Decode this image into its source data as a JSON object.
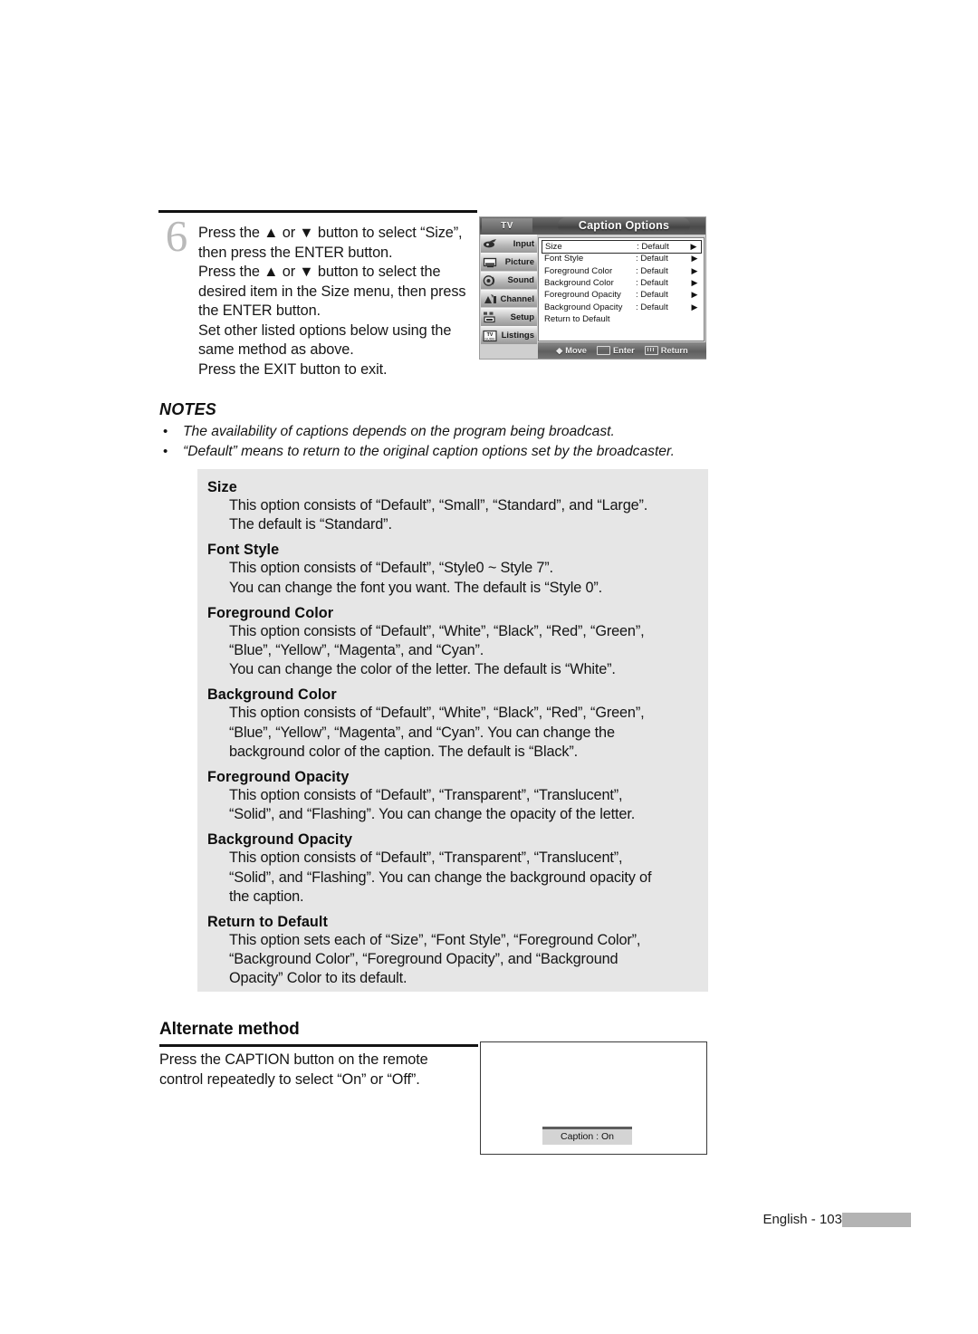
{
  "step": {
    "number": "6",
    "lines": [
      "Press the ▲ or ▼ button to select “Size”,",
      "then press the ENTER button.",
      "Press the ▲ or ▼ button to select the",
      "desired item in the Size menu, then press",
      "the ENTER button.",
      "Set other listed options below using the",
      "same method as above.",
      "Press the EXIT button to exit."
    ]
  },
  "osd": {
    "tv_tab": "TV",
    "title": "Caption Options",
    "sidebar": [
      {
        "label": "Input",
        "icon": "input-icon"
      },
      {
        "label": "Picture",
        "icon": "picture-icon"
      },
      {
        "label": "Sound",
        "icon": "sound-icon"
      },
      {
        "label": "Channel",
        "icon": "channel-icon"
      },
      {
        "label": "Setup",
        "icon": "setup-icon"
      },
      {
        "label": "Listings",
        "icon": "listings-icon"
      }
    ],
    "rows": [
      {
        "label": "Size",
        "value": ": Default",
        "arrow": "▶",
        "selected": true
      },
      {
        "label": "Font Style",
        "value": ": Default",
        "arrow": "▶",
        "selected": false
      },
      {
        "label": "Foreground Color",
        "value": ": Default",
        "arrow": "▶",
        "selected": false
      },
      {
        "label": "Background Color",
        "value": ": Default",
        "arrow": "▶",
        "selected": false
      },
      {
        "label": "Foreground Opacity",
        "value": ": Default",
        "arrow": "▶",
        "selected": false
      },
      {
        "label": "Background Opacity",
        "value": ": Default",
        "arrow": "▶",
        "selected": false
      },
      {
        "label": "Return to Default",
        "value": "",
        "arrow": "",
        "selected": false
      }
    ],
    "footer": {
      "move": "Move",
      "enter": "Enter",
      "return": "Return"
    }
  },
  "notes": {
    "title": "NOTES",
    "items": [
      "The availability of captions depends on the program being broadcast.",
      "“Default” means to return to the original caption options set by the broadcaster."
    ]
  },
  "definitions": [
    {
      "term": "Size",
      "lines": [
        "This option consists of “Default”, “Small”, “Standard”, and “Large”.",
        "The default is “Standard”."
      ]
    },
    {
      "term": "Font Style",
      "lines": [
        "This option consists of “Default”, “Style0 ~ Style 7”.",
        "You can change the font you want. The default is “Style 0”."
      ]
    },
    {
      "term": "Foreground Color",
      "lines": [
        "This option consists of “Default”, “White”, “Black”, “Red”, “Green”,",
        "“Blue”, “Yellow”, “Magenta”, and “Cyan”.",
        "You can change the color of the letter. The default is “White”."
      ]
    },
    {
      "term": "Background Color",
      "lines": [
        "This option consists of “Default”, “White”, “Black”, “Red”, “Green”,",
        "“Blue”, “Yellow”, “Magenta”, and “Cyan”. You can change the",
        "background color of the caption. The default is “Black”."
      ]
    },
    {
      "term": "Foreground Opacity",
      "lines": [
        "This option consists of “Default”, “Transparent”, “Translucent”,",
        "“Solid”, and “Flashing”. You can change the opacity of the letter."
      ]
    },
    {
      "term": "Background Opacity",
      "lines": [
        "This option consists of “Default”, “Transparent”, “Translucent”,",
        "“Solid”, and “Flashing”. You can change the background opacity of",
        "the caption."
      ]
    },
    {
      "term": "Return to Default",
      "lines": [
        "This option sets each of “Size”, “Font Style”, “Foreground Color”,",
        "“Background Color”, “Foreground Opacity”, and “Background",
        "Opacity” Color to its default."
      ]
    }
  ],
  "alternate": {
    "title": "Alternate method",
    "lines": [
      "Press the CAPTION button on the remote",
      "control repeatedly to select “On” or “Off”."
    ]
  },
  "preview": {
    "caption_chip": "Caption : On"
  },
  "footer": {
    "page": "English - 103"
  }
}
